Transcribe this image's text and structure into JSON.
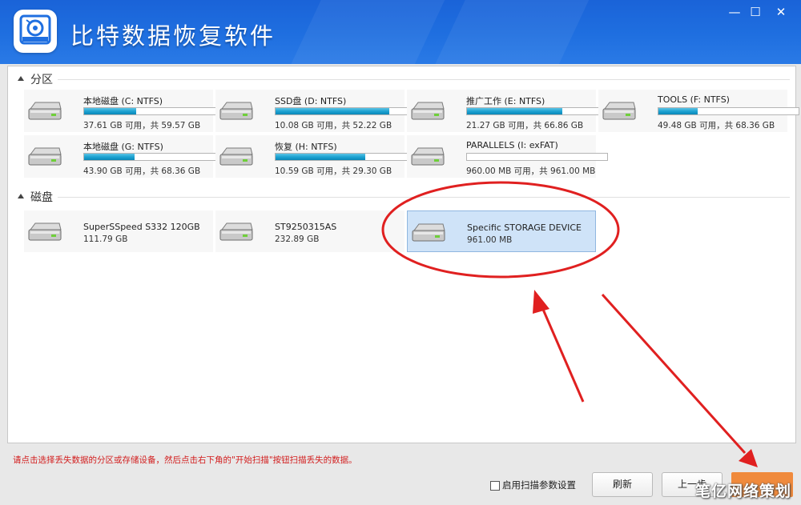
{
  "window": {
    "title": "比特数据恢复软件",
    "controls": [
      "minimize",
      "maximize",
      "close"
    ],
    "minimize_glyph": "—",
    "maximize_glyph": "☐",
    "close_glyph": "✕"
  },
  "partitions": {
    "header": "分区",
    "items": [
      {
        "name": "本地磁盘 (C: NTFS)",
        "capacity": "37.61 GB 可用，共 59.57 GB",
        "used_fraction": 0.37
      },
      {
        "name": "SSD盘 (D: NTFS)",
        "capacity": "10.08 GB 可用，共 52.22 GB",
        "used_fraction": 0.81
      },
      {
        "name": "推广工作 (E: NTFS)",
        "capacity": "21.27 GB 可用，共 66.86 GB",
        "used_fraction": 0.68
      },
      {
        "name": "TOOLS (F: NTFS)",
        "capacity": "49.48 GB 可用，共 68.36 GB",
        "used_fraction": 0.28
      },
      {
        "name": "本地磁盘 (G: NTFS)",
        "capacity": "43.90 GB 可用，共 68.36 GB",
        "used_fraction": 0.36
      },
      {
        "name": "恢复 (H: NTFS)",
        "capacity": "10.59 GB 可用，共 29.30 GB",
        "used_fraction": 0.64
      },
      {
        "name": "PARALLELS (I: exFAT)",
        "capacity": "960.00 MB 可用，共 961.00 MB",
        "used_fraction": 0.0
      }
    ]
  },
  "disks": {
    "header": "磁盘",
    "items": [
      {
        "name": "SuperSSpeed S332 120GB",
        "capacity": "111.79 GB",
        "selected": false
      },
      {
        "name": "ST9250315AS",
        "capacity": "232.89 GB",
        "selected": false
      },
      {
        "name": "Specific STORAGE DEVICE",
        "capacity": "961.00 MB",
        "selected": true
      }
    ]
  },
  "status_message": "请点击选择丢失数据的分区或存储设备，然后点击右下角的\"开始扫描\"按钮扫描丢失的数据。",
  "footer": {
    "checkbox_label": "启用扫描参数设置",
    "refresh_label": "刷新",
    "prev_label": "上一步",
    "watermark": "笔亿网络策划"
  },
  "colors": {
    "titlebar": "#1f6fe0",
    "accent_bar": "#1ea3d2",
    "annotation_red": "#e02020",
    "start_button": "#f08a3c",
    "selection": "#cfe3f8"
  },
  "icons": {
    "drive": "hard-drive-icon",
    "logo": "disk-recovery-logo-icon"
  }
}
